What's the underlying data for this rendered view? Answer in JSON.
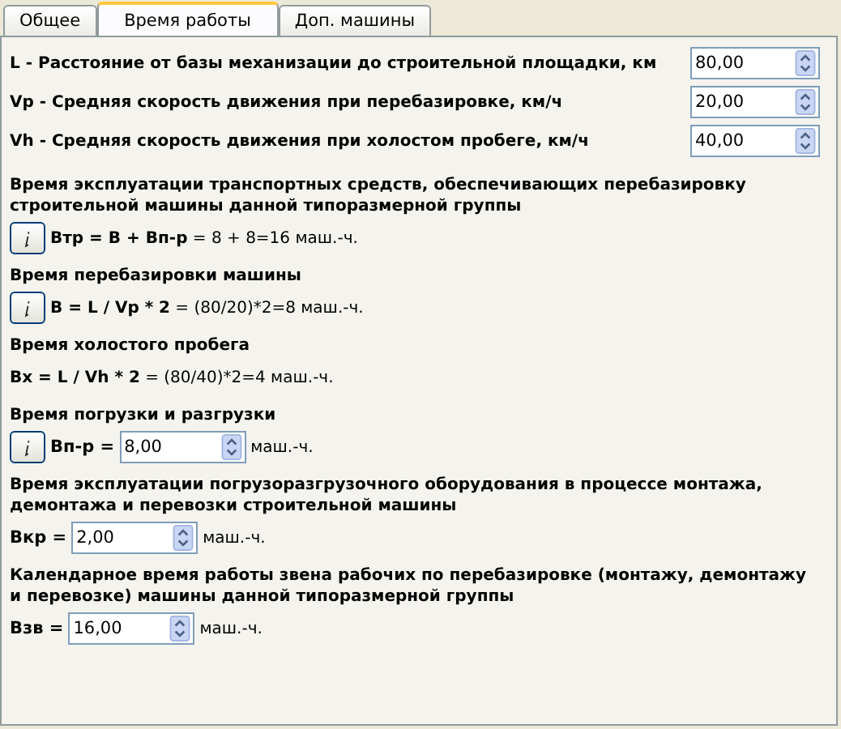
{
  "tabs": [
    {
      "label": "Общее",
      "selected": false
    },
    {
      "label": "Время работы",
      "selected": true
    },
    {
      "label": "Доп. машины",
      "selected": false
    }
  ],
  "params": [
    {
      "label": "L - Расстояние от базы механизации до строительной площадки, км",
      "value": "80,00"
    },
    {
      "label": "Vp - Средняя скорость движения при перебазировке, км/ч",
      "value": "20,00"
    },
    {
      "label": "Vh - Средняя скорость движения при холостом пробеге, км/ч",
      "value": "40,00"
    }
  ],
  "sections": [
    {
      "title": "Время эксплуатации транспортных средств, обеспечивающих перебазировку строительной машины данной типоразмерной группы",
      "info": true,
      "kind": "formula",
      "formula": "**Втр = В + Вп-р** = 8 + 8=16 маш.-ч."
    },
    {
      "title": "Время перебазировки машины",
      "info": true,
      "kind": "formula",
      "formula": "**В = L / Vp * 2** = (80/20)*2=8 маш.-ч."
    },
    {
      "title": "Время холостого пробега",
      "info": false,
      "kind": "formula",
      "formula": "**Вх = L / Vh * 2** = (80/40)*2=4 маш.-ч."
    },
    {
      "title": "Время погрузки и разгрузки",
      "info": true,
      "kind": "input",
      "label": "Вп-р =",
      "value": "8,00",
      "unit": "маш.-ч."
    },
    {
      "title": "Время эксплуатации погрузоразгрузочного оборудования в процессе монтажа, демонтажа и перевозки строительной машины",
      "info": false,
      "kind": "input",
      "label": "Вкр =",
      "value": "2,00",
      "unit": "маш.-ч."
    },
    {
      "title": "Календарное время работы звена рабочих по перебазировке (монтажу, демонтажу и перевозке) машины данной типоразмерной группы",
      "info": false,
      "kind": "input",
      "label": "Взв =",
      "value": "16,00",
      "unit": "маш.-ч."
    }
  ]
}
